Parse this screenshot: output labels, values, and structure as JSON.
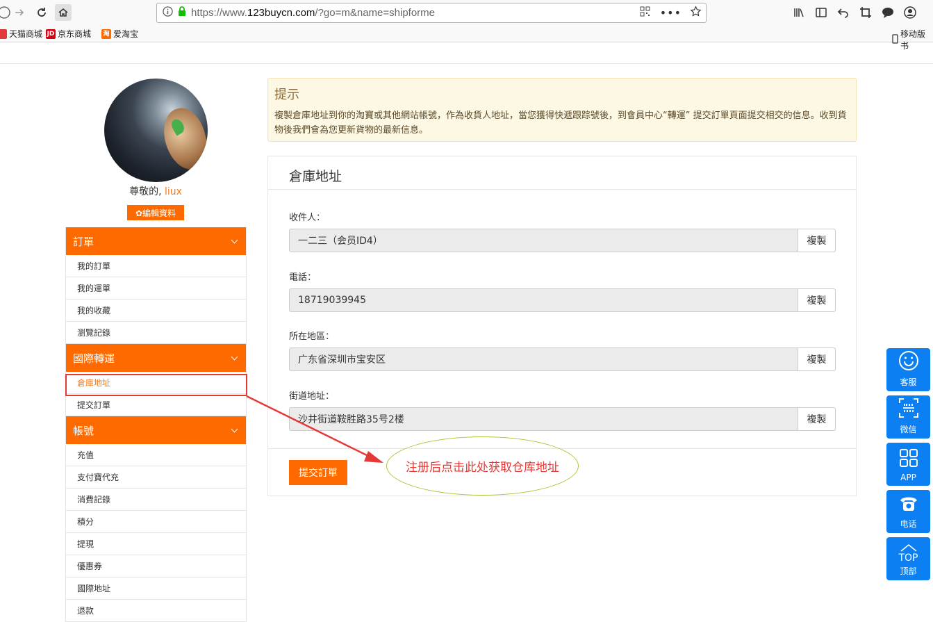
{
  "browser": {
    "url_prefix": "https://www.",
    "url_domain": "123buycn.com",
    "url_path": "/?go=m&name=shipforme",
    "bookmarks": [
      {
        "label": "天猫商城",
        "icon": "tmall-icon",
        "color": "#e4393c"
      },
      {
        "label": "京东商城",
        "icon": "jd-icon",
        "color": "#d7000f"
      },
      {
        "label": "爱淘宝",
        "icon": "taobao-icon",
        "color": "#ff6a00"
      }
    ],
    "mobile_bookmark": "移动版书"
  },
  "user": {
    "greeting": "尊敬的,",
    "username": "liux",
    "edit_label": "✿編輯資料"
  },
  "sidebar": {
    "groups": [
      {
        "title": "訂單",
        "items": [
          "我的訂單",
          "我的運單",
          "我的收藏",
          "瀏覽記錄"
        ]
      },
      {
        "title": "國際轉運",
        "items": [
          "倉庫地址",
          "提交訂單"
        ]
      },
      {
        "title": "帳號",
        "items": [
          "充值",
          "支付寶代充",
          "消費記錄",
          "積分",
          "提現",
          "優惠券",
          "國際地址",
          "退款"
        ]
      }
    ],
    "active_item": "倉庫地址"
  },
  "tip": {
    "title": "提示",
    "text": "複製倉庫地址到你的淘寶或其他網站帳號，作為收貨人地址，當您獲得快遞跟踪號後，到會員中心“轉運” 提交訂單頁面提交相交的信息。收到貨物後我們會為您更新貨物的最新信息。"
  },
  "panel": {
    "title": "倉庫地址",
    "copy_label": "複製",
    "fields": [
      {
        "label": "收件人：",
        "value": "一二三（会员ID4）"
      },
      {
        "label": "電話：",
        "value": "18719039945"
      },
      {
        "label": "所在地區：",
        "value": "广东省深圳市宝安区"
      },
      {
        "label": "街道地址：",
        "value": "沙井街道鞍胜路35号2楼"
      }
    ],
    "submit_label": "提交訂單"
  },
  "annotation": {
    "note": "注册后点击此处获取仓库地址",
    "arrow_color": "#e53935"
  },
  "float_bar": [
    {
      "label": "客服",
      "icon": "smile-icon"
    },
    {
      "label": "微信",
      "icon": "qrcode-icon"
    },
    {
      "label": "APP",
      "icon": "app-grid-icon"
    },
    {
      "label": "电话",
      "icon": "phone-icon"
    },
    {
      "label": "顶部",
      "icon": "top-icon",
      "text": "TOP"
    }
  ]
}
